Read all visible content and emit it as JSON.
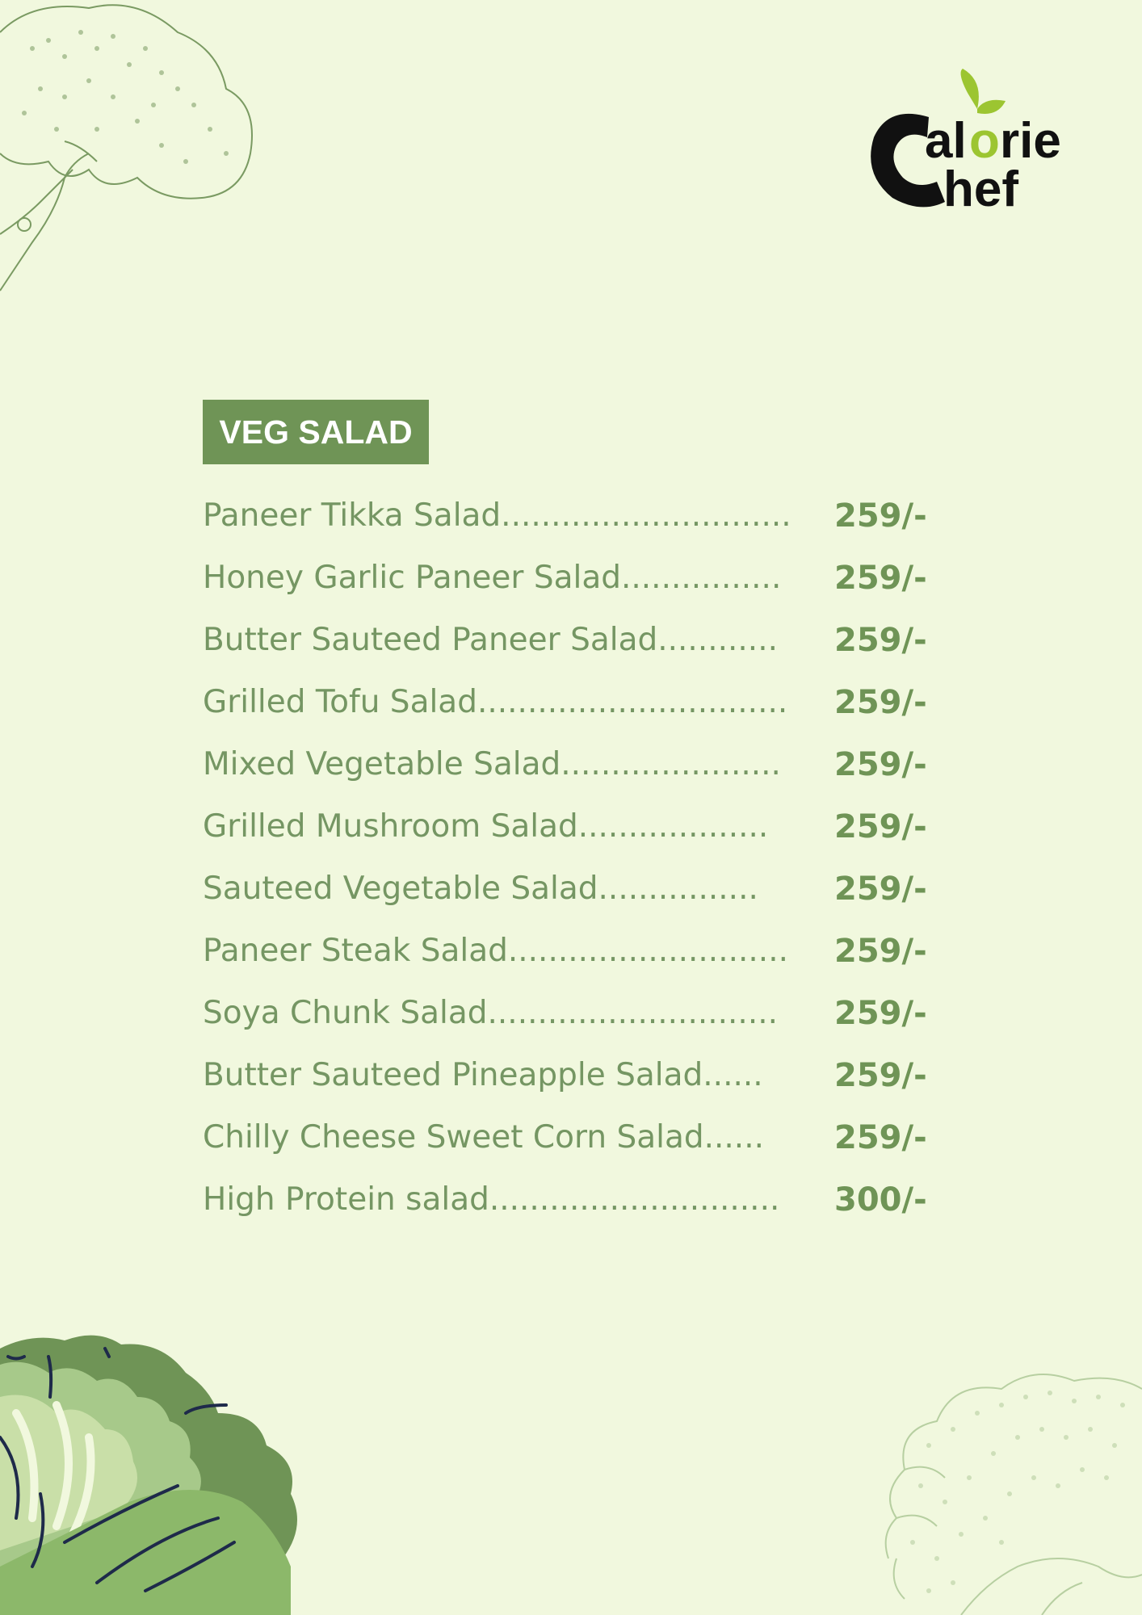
{
  "brand": {
    "logo_text": "Calorie Chef"
  },
  "section": {
    "title": "VEG SALAD"
  },
  "menu": {
    "items": [
      {
        "name": "Paneer Tikka Salad.............................",
        "price": "259/-"
      },
      {
        "name": "Honey Garlic Paneer Salad................",
        "price": "259/-"
      },
      {
        "name": "Butter Sauteed Paneer Salad............",
        "price": "259/-"
      },
      {
        "name": "Grilled Tofu Salad...............................",
        "price": "259/-"
      },
      {
        "name": "Mixed Vegetable Salad......................",
        "price": "259/-"
      },
      {
        "name": "Grilled Mushroom Salad...................",
        "price": "259/-"
      },
      {
        "name": "Sauteed Vegetable Salad................",
        "price": "259/-"
      },
      {
        "name": "Paneer Steak Salad............................",
        "price": "259/-"
      },
      {
        "name": "Soya Chunk Salad.............................",
        "price": "259/-"
      },
      {
        "name": "Butter Sauteed Pineapple Salad......",
        "price": "259/-"
      },
      {
        "name": "Chilly Cheese Sweet Corn Salad......",
        "price": "259/-"
      },
      {
        "name": "High Protein salad.............................",
        "price": "300/-"
      }
    ]
  },
  "colors": {
    "background": "#f1f8de",
    "accent": "#6f9456",
    "text": "#759663",
    "logo_dark": "#111111",
    "logo_leaf": "#9cc531"
  }
}
